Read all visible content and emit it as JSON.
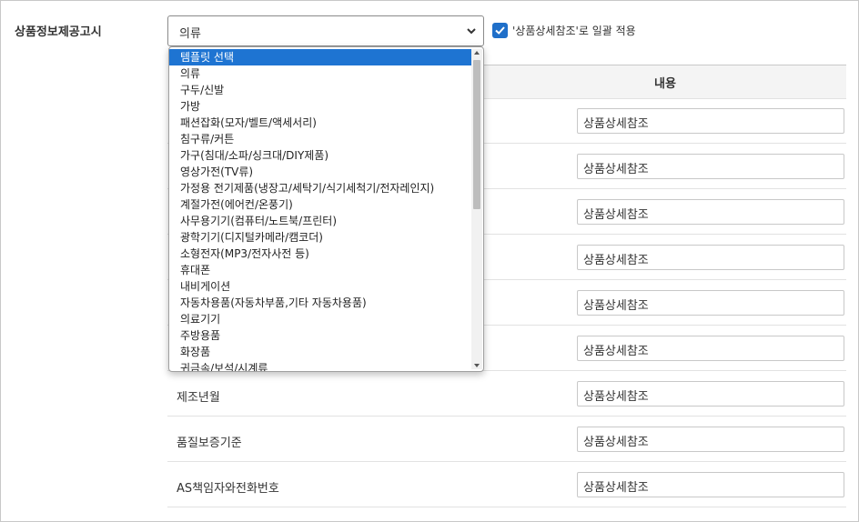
{
  "section": {
    "label": "상품정보제공고시"
  },
  "template_select": {
    "value": "의류",
    "icon": "chevron-down-icon"
  },
  "apply_all": {
    "checked": true,
    "label": "'상품상세참조'로 일괄 적용",
    "icon": "checkmark-icon"
  },
  "table": {
    "header": "내용",
    "rows": [
      {
        "label": "",
        "value": "상품상세참조"
      },
      {
        "label": "",
        "value": "상품상세참조"
      },
      {
        "label": "",
        "value": "상품상세참조"
      },
      {
        "label": "",
        "value": "상품상세참조"
      },
      {
        "label": "",
        "value": "상품상세참조"
      },
      {
        "label": "",
        "value": "상품상세참조"
      },
      {
        "label": "제조년월",
        "value": "상품상세참조"
      },
      {
        "label": "품질보증기준",
        "value": "상품상세참조"
      },
      {
        "label": "AS책임자와전화번호",
        "value": "상품상세참조"
      }
    ]
  },
  "dropdown": {
    "selected_index": 0,
    "options": [
      "템플릿 선택",
      "의류",
      "구두/신발",
      "가방",
      "패션잡화(모자/벨트/액세서리)",
      "침구류/커튼",
      "가구(침대/소파/싱크대/DIY제품)",
      "영상가전(TV류)",
      "가정용 전기제품(냉장고/세탁기/식기세척기/전자레인지)",
      "계절가전(에어컨/온풍기)",
      "사무용기기(컴퓨터/노트북/프린터)",
      "광학기기(디지털카메라/캠코더)",
      "소형전자(MP3/전자사전 등)",
      "휴대폰",
      "내비게이션",
      "자동차용품(자동차부품,기타 자동차용품)",
      "의료기기",
      "주방용품",
      "화장품",
      "귀금속/보석/시계류"
    ]
  },
  "colors": {
    "accent": "#1e74d2",
    "checkbox": "#1f6fc9",
    "border": "#c8c8c8"
  }
}
